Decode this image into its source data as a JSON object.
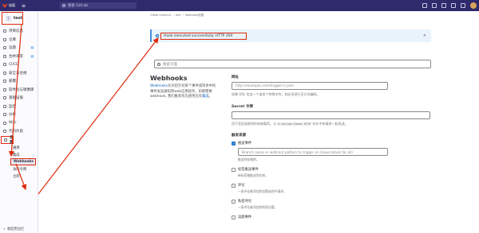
{
  "topbar": {
    "brand": "极狐",
    "search_placeholder": "搜索 GitLab"
  },
  "sidebar": {
    "project_initial": "T",
    "project_name": "test",
    "items": [
      {
        "label": "项目信息",
        "icon": "info-icon",
        "badge": ""
      },
      {
        "label": "仓库",
        "icon": "repo-icon",
        "badge": ""
      },
      {
        "label": "议题",
        "icon": "issues-icon",
        "badge": "0"
      },
      {
        "label": "合并请求",
        "icon": "merge-request-icon",
        "badge": "0"
      },
      {
        "label": "CI/CD",
        "icon": "rocket-icon",
        "badge": ""
      },
      {
        "label": "安全与合规",
        "icon": "shield-icon",
        "badge": ""
      },
      {
        "label": "部署",
        "icon": "deploy-icon",
        "badge": ""
      },
      {
        "label": "软件包与镜像库",
        "icon": "package-icon",
        "badge": ""
      },
      {
        "label": "基础设施",
        "icon": "cloud-icon",
        "badge": ""
      },
      {
        "label": "监控",
        "icon": "monitor-icon",
        "badge": ""
      },
      {
        "label": "分析",
        "icon": "chart-icon",
        "badge": ""
      },
      {
        "label": "Wiki",
        "icon": "book-icon",
        "badge": ""
      },
      {
        "label": "代码片段",
        "icon": "snippet-icon",
        "badge": ""
      }
    ],
    "settings_label": "设置",
    "settings_sub": [
      "通用",
      "集成",
      "Webhooks",
      "访问令牌",
      "仓库"
    ],
    "collapse_label": "收起侧边栏"
  },
  "breadcrumb": [
    "Gitlab Instance",
    "test",
    "Webhook设置"
  ],
  "alert": {
    "message": "Hook executed successfully: HTTP 200",
    "close": "×"
  },
  "filter_placeholder": "搜索页面",
  "intro": {
    "title": "Webhooks",
    "p1_link": "Webhooks",
    "p1": "允许您针对某个事件或项目中的事件发送通知到web应用程序。如果需要webhook, 我们推荐优先使用已有",
    "p1_link2": "集成",
    "p1_end": "。"
  },
  "form": {
    "url_label": "网址",
    "url_placeholder": "http://example.com/trigger-ci.json",
    "url_hint": "如果 URL 包含一个或多个特殊字符，则必须进行百分号编码。",
    "secret_label": "Secret 令牌",
    "secret_hint_a": "用于验证接收到的有效载荷。与",
    "secret_hint_code": "X-Gitlab-Token HTTP",
    "secret_hint_b": "标头中的请求一起发送。",
    "trigger_label": "触发来源",
    "triggers": [
      {
        "label": "推送事件",
        "checked": true,
        "desc": "推送到存储库。"
      },
      {
        "label": "标签推送事件",
        "checked": false,
        "desc": "新标签被推送到仓库。"
      },
      {
        "label": "评论",
        "checked": false,
        "desc": "一条评论被添加到议题或合并请求。"
      },
      {
        "label": "私密评论",
        "checked": false,
        "desc": "一条评论被添加到机密议题。"
      },
      {
        "label": "议题事件",
        "checked": false,
        "desc": ""
      }
    ],
    "branch_placeholder": "Branch name or wildcard pattern to trigger on (leave blank for all)"
  }
}
